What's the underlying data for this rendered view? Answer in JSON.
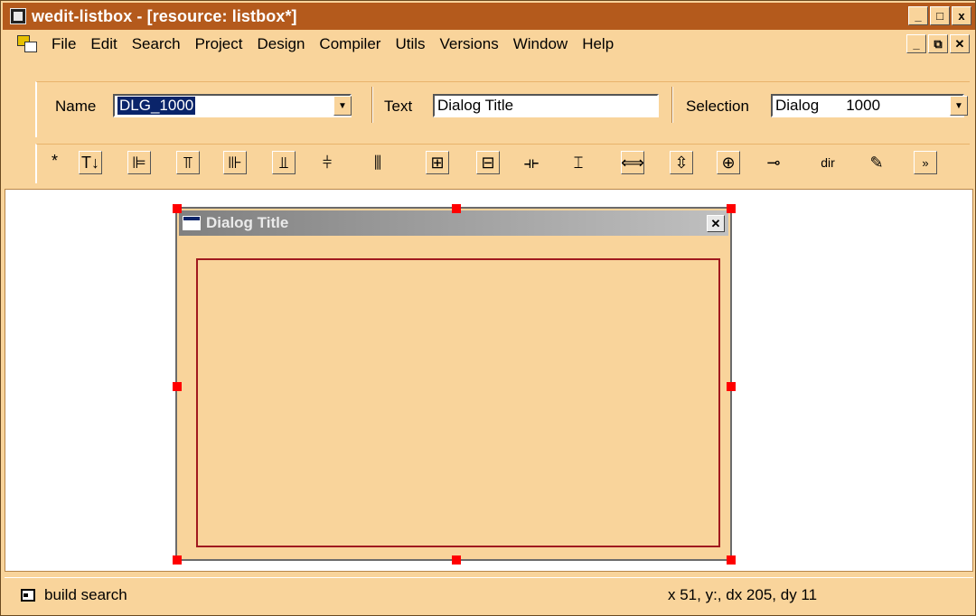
{
  "window": {
    "title": "wedit-listbox - [resource: listbox*]",
    "buttons": [
      "_",
      "□",
      "x"
    ]
  },
  "menu": {
    "items": [
      "File",
      "Edit",
      "Search",
      "Project",
      "Design",
      "Compiler",
      "Utils",
      "Versions",
      "Window",
      "Help"
    ],
    "mdi_buttons": [
      "_",
      "⧉",
      "✕"
    ]
  },
  "properties": {
    "name_label": "Name",
    "name_value": "DLG_1000",
    "text_label": "Text",
    "text_value": "Dialog Title",
    "selection_label": "Selection",
    "selection_type": "Dialog",
    "selection_id": "1000"
  },
  "align_toolbar": {
    "star": "*",
    "tools": [
      {
        "name": "text-order-icon",
        "glyph": "T↓"
      },
      {
        "name": "align-left-icon",
        "glyph": "⊫"
      },
      {
        "name": "align-top-icon",
        "glyph": "⫪"
      },
      {
        "name": "align-right-icon",
        "glyph": "⊪"
      },
      {
        "name": "align-bottom-icon",
        "glyph": "⫫"
      },
      {
        "name": "center-horizontal-icon",
        "glyph": "⫩"
      },
      {
        "name": "center-vertical-icon",
        "glyph": "⫼"
      },
      {
        "name": "space-vertical-icon",
        "glyph": "⊞"
      },
      {
        "name": "space-horizontal-icon",
        "glyph": "⊟"
      },
      {
        "name": "same-width-icon",
        "glyph": "⟛"
      },
      {
        "name": "same-height-icon",
        "glyph": "⌶"
      },
      {
        "name": "stretch-horizontal-icon",
        "glyph": "⟺"
      },
      {
        "name": "stretch-vertical-icon",
        "glyph": "⇳"
      },
      {
        "name": "center-both-icon",
        "glyph": "⊕"
      },
      {
        "name": "pin-icon",
        "glyph": "⊸"
      },
      {
        "name": "dir-icon",
        "glyph": "dir"
      },
      {
        "name": "cursor-icon",
        "glyph": "✎"
      },
      {
        "name": "more-icon",
        "glyph": "»"
      }
    ]
  },
  "dialog": {
    "title": "Dialog Title",
    "close_glyph": "✕"
  },
  "status": {
    "text": "build  search",
    "coords": "x 51, y:, dx 205, dy 11"
  },
  "colors": {
    "background": "#f9d49b",
    "titlebar": "#b45a1c",
    "selection": "#0a246a",
    "handle": "#ff0000",
    "frame": "#a0191e"
  }
}
